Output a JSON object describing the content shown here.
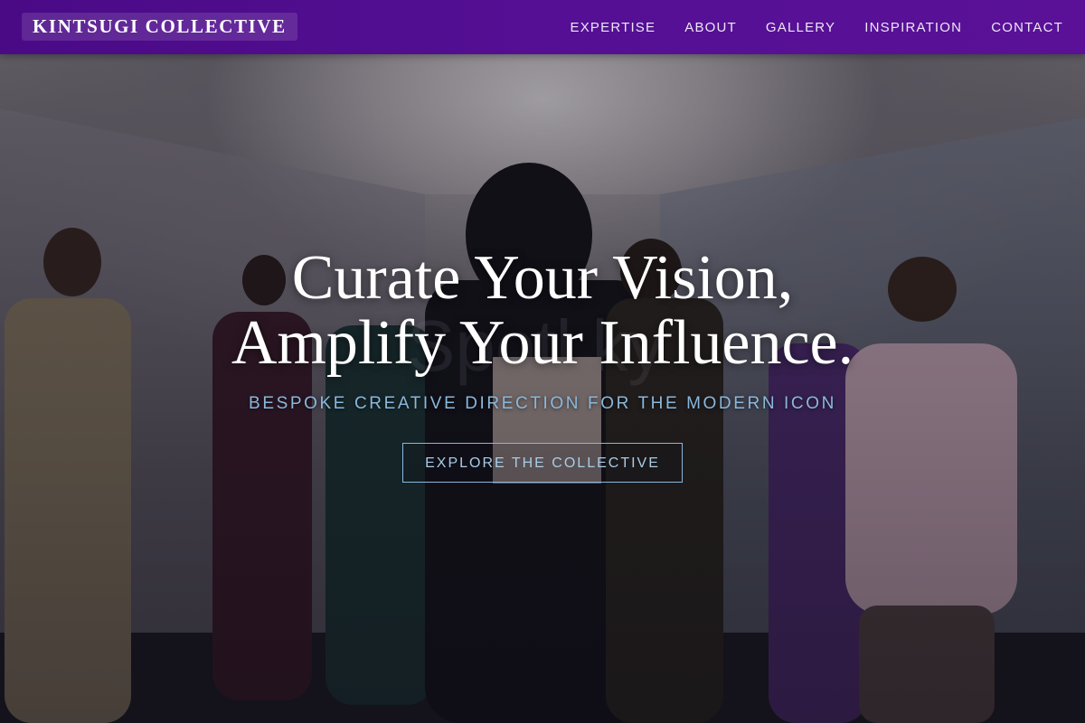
{
  "brand": {
    "name": "KINTSUGI COLLECTIVE"
  },
  "nav": {
    "items": [
      {
        "label": "EXPERTISE"
      },
      {
        "label": "ABOUT"
      },
      {
        "label": "GALLERY"
      },
      {
        "label": "INSPIRATION"
      },
      {
        "label": "CONTACT"
      }
    ]
  },
  "hero": {
    "headline_line1": "Curate Your Vision,",
    "headline_line2": "Amplify Your Influence.",
    "subtitle": "BESPOKE CREATIVE DIRECTION FOR THE MODERN ICON",
    "cta_label": "EXPLORE THE COLLECTIVE"
  },
  "colors": {
    "nav_background": "#540f94",
    "subtitle_accent": "#8ab8dc",
    "headline_text": "#ffffff"
  }
}
